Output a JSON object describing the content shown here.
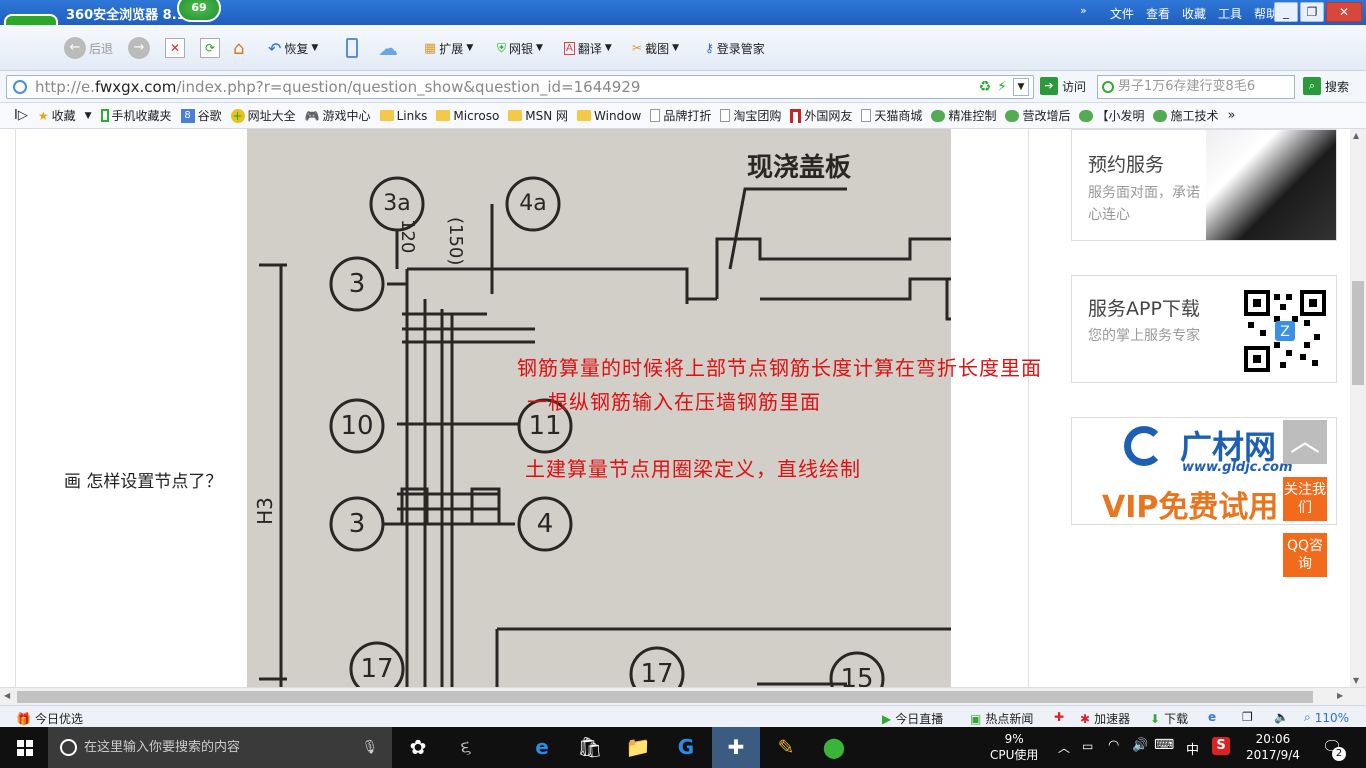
{
  "browser": {
    "title": "360安全浏览器 8.1",
    "badge": "69",
    "logo_letter": "e",
    "menus": [
      "文件",
      "查看",
      "收藏",
      "工具",
      "帮助"
    ],
    "window_buttons": [
      "_",
      "❐",
      "✕"
    ]
  },
  "toolbar": {
    "back": "后退",
    "restore": "恢复",
    "extend": "扩展",
    "bank": "网银",
    "translate": "翻译",
    "screenshot": "截图",
    "login_manager": "登录管家"
  },
  "address": {
    "url_prefix": "http://e.",
    "url_domain": "fwxgx.com",
    "url_path": "/index.php?r=question/question_show&question_id=1644929",
    "visit": "访问",
    "search_placeholder": "男子1万6存建行变8毛6",
    "search": "搜索"
  },
  "favorites": [
    {
      "label": "收藏",
      "icon": "star-icon"
    },
    {
      "label": "手机收藏夹",
      "icon": "phone-icon"
    },
    {
      "label": "谷歌",
      "icon": "google-icon"
    },
    {
      "label": "网址大全",
      "icon": "plus-icon"
    },
    {
      "label": "游戏中心",
      "icon": "gamepad-icon"
    },
    {
      "label": "Links",
      "icon": "folder-icon"
    },
    {
      "label": "Microso",
      "icon": "folder-icon"
    },
    {
      "label": "MSN 网",
      "icon": "folder-icon"
    },
    {
      "label": "Window",
      "icon": "folder-icon"
    },
    {
      "label": "品牌打折",
      "icon": "page-icon"
    },
    {
      "label": "淘宝团购",
      "icon": "page-icon"
    },
    {
      "label": "外国网友",
      "icon": "page-icon"
    },
    {
      "label": "天猫商城",
      "icon": "page-icon"
    },
    {
      "label": "精准控制",
      "icon": "bubble-icon"
    },
    {
      "label": "营改增后",
      "icon": "bubble-icon"
    },
    {
      "label": "【小发明",
      "icon": "bubble-icon"
    },
    {
      "label": "施工技术",
      "icon": "bubble-icon"
    }
  ],
  "content": {
    "question": "画 怎样设置节点了？",
    "drawing": {
      "header_label": "现浇盖板",
      "dims": [
        "120",
        "(150)"
      ],
      "side_label": "H3",
      "circles": [
        "3a",
        "4a",
        "3",
        "10",
        "11",
        "3",
        "4",
        "17",
        "17",
        "15"
      ],
      "annotations": [
        "钢筋算量的时候将上部节点钢筋长度计算在弯折长度里面",
        "一根纵钢筋输入在压墙钢筋里面",
        "土建算量节点用圈梁定义，直线绘制"
      ]
    }
  },
  "sidebar": {
    "appointment": {
      "title": "预约服务",
      "subtitle": "服务面对面，承诺心连心"
    },
    "app": {
      "title": "服务APP下载",
      "subtitle": "您的掌上服务专家"
    },
    "vip": {
      "brand": "广材网",
      "domain": "www.gldjc.com",
      "promo": "VIP免费试用"
    },
    "follow": "关注我们",
    "qq": "QQ咨询"
  },
  "statusbar": {
    "today_pick": "今日优选",
    "live": "今日直播",
    "hot_news": "热点新闻",
    "accelerator": "加速器",
    "download": "下载",
    "zoom": "110%"
  },
  "taskbar": {
    "search_placeholder": "在这里输入你要搜索的内容",
    "cpu_percent": "9%",
    "cpu_label": "CPU使用",
    "ime": "中",
    "time": "20:06",
    "date": "2017/9/4",
    "notifications": "2"
  },
  "colors": {
    "annotation_red": "#e01010",
    "follow_orange": "#f26b1d",
    "titlebar_blue": "#2f78d8",
    "brand_green": "#2aa82a"
  }
}
